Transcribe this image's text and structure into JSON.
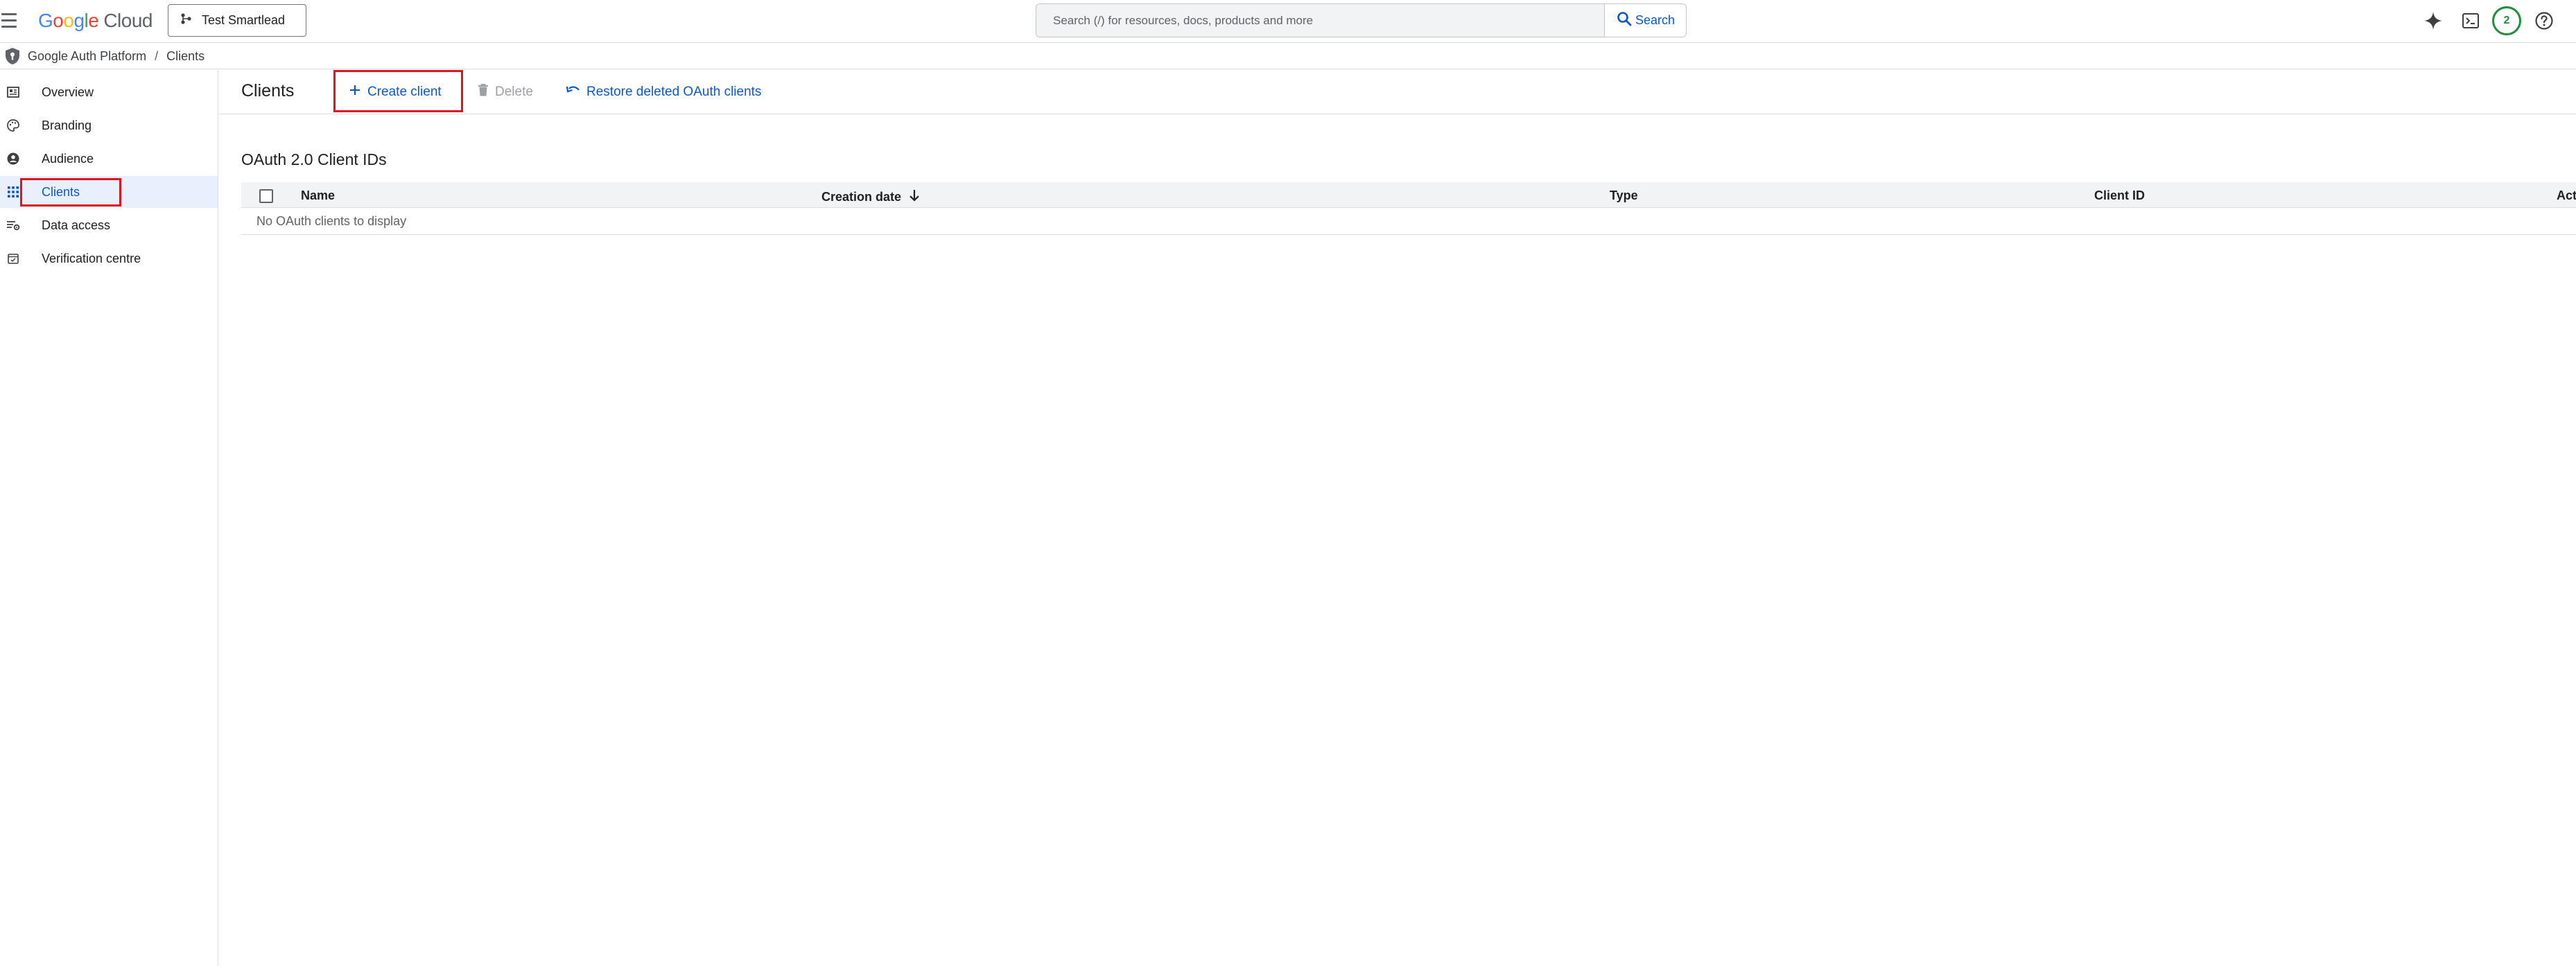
{
  "topbar": {
    "menu_icon": "hamburger-menu-icon",
    "logo": {
      "part1": "Google",
      "part2": "Cloud"
    },
    "project_selector": "Test Smartlead",
    "search": {
      "placeholder": "Search (/) for resources, docs, products and more",
      "button_label": "Search"
    },
    "icons": [
      "gemini-sparkle-icon",
      "cloud-shell-terminal-icon",
      "help-icon"
    ],
    "notifications_count": "2"
  },
  "breadcrumb": {
    "items": [
      "Google Auth Platform",
      "Clients"
    ],
    "separator": "/"
  },
  "sidebar": {
    "items": [
      {
        "label": "Overview",
        "icon": "overview-icon"
      },
      {
        "label": "Branding",
        "icon": "palette-icon"
      },
      {
        "label": "Audience",
        "icon": "person-icon"
      },
      {
        "label": "Clients",
        "icon": "apps-grid-icon",
        "active": true
      },
      {
        "label": "Data access",
        "icon": "data-access-icon"
      },
      {
        "label": "Verification centre",
        "icon": "verification-icon"
      }
    ]
  },
  "main": {
    "title": "Clients",
    "actions": {
      "create": "Create client",
      "delete": "Delete",
      "restore": "Restore deleted OAuth clients"
    },
    "section_title": "OAuth 2.0 Client IDs",
    "table": {
      "columns": [
        "Name",
        "Creation date",
        "Type",
        "Client ID",
        "Actions"
      ],
      "sort_column": "Creation date",
      "sort_direction": "descending",
      "empty_message": "No OAuth clients to display"
    }
  },
  "colors": {
    "accent": "#0b57d0",
    "highlight_box": "#e0141e",
    "active_nav_bg": "#e8f0fe",
    "avatar_ring": "#1e8e3e"
  }
}
